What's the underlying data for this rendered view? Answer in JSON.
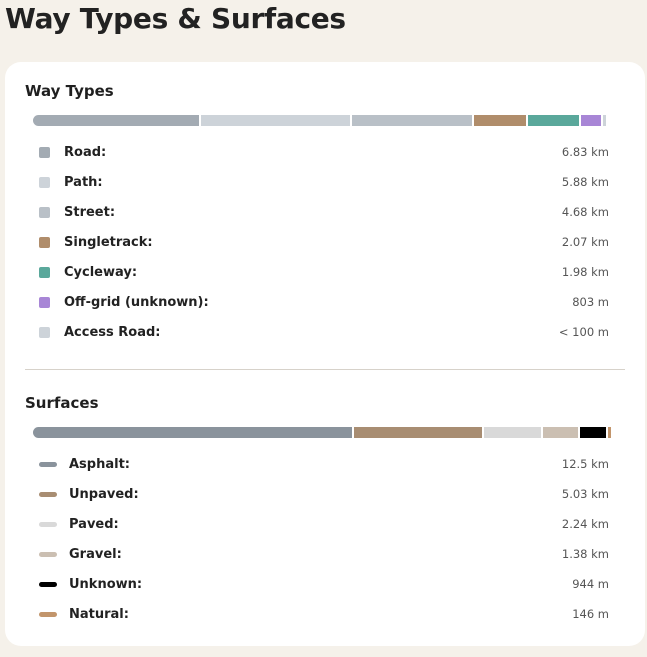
{
  "page": {
    "title": "Way Types & Surfaces"
  },
  "way_types": {
    "title": "Way Types",
    "bar": [
      {
        "share": 0.29,
        "color": "#a3abb3"
      },
      {
        "share": 0.26,
        "color": "#cdd3d9"
      },
      {
        "share": 0.21,
        "color": "#b9c0c7"
      },
      {
        "share": 0.092,
        "color": "#b08d6b"
      },
      {
        "share": 0.088,
        "color": "#5aa89b"
      },
      {
        "share": 0.036,
        "color": "#a886d6"
      },
      {
        "share": 0.004,
        "color": "#cdd3d9"
      }
    ],
    "items": [
      {
        "label": "Road:",
        "value": "6.83 km",
        "color": "#a3abb3"
      },
      {
        "label": "Path:",
        "value": "5.88 km",
        "color": "#cdd3d9"
      },
      {
        "label": "Street:",
        "value": "4.68 km",
        "color": "#b9c0c7"
      },
      {
        "label": "Singletrack:",
        "value": "2.07 km",
        "color": "#b08d6b"
      },
      {
        "label": "Cycleway:",
        "value": "1.98 km",
        "color": "#5aa89b"
      },
      {
        "label": "Off-grid (unknown):",
        "value": "803 m",
        "color": "#a886d6"
      },
      {
        "label": "Access Road:",
        "value": "< 100 m",
        "color": "#cdd3d9"
      }
    ]
  },
  "surfaces": {
    "title": "Surfaces",
    "bar": [
      {
        "share": 0.555,
        "color": "#8a939c"
      },
      {
        "share": 0.223,
        "color": "#a88d72"
      },
      {
        "share": 0.1,
        "color": "#d9d9d9"
      },
      {
        "share": 0.061,
        "color": "#cbbfb2"
      },
      {
        "share": 0.045,
        "color": "#000000"
      },
      {
        "share": 0.006,
        "color": "#c2956b"
      }
    ],
    "items": [
      {
        "label": "Asphalt:",
        "value": "12.5 km",
        "color": "#8a939c"
      },
      {
        "label": "Unpaved:",
        "value": "5.03 km",
        "color": "#a88d72"
      },
      {
        "label": "Paved:",
        "value": "2.24 km",
        "color": "#d9d9d9"
      },
      {
        "label": "Gravel:",
        "value": "1.38 km",
        "color": "#cbbfb2"
      },
      {
        "label": "Unknown:",
        "value": "944 m",
        "color": "#000000"
      },
      {
        "label": "Natural:",
        "value": "146 m",
        "color": "#c2956b"
      }
    ]
  }
}
